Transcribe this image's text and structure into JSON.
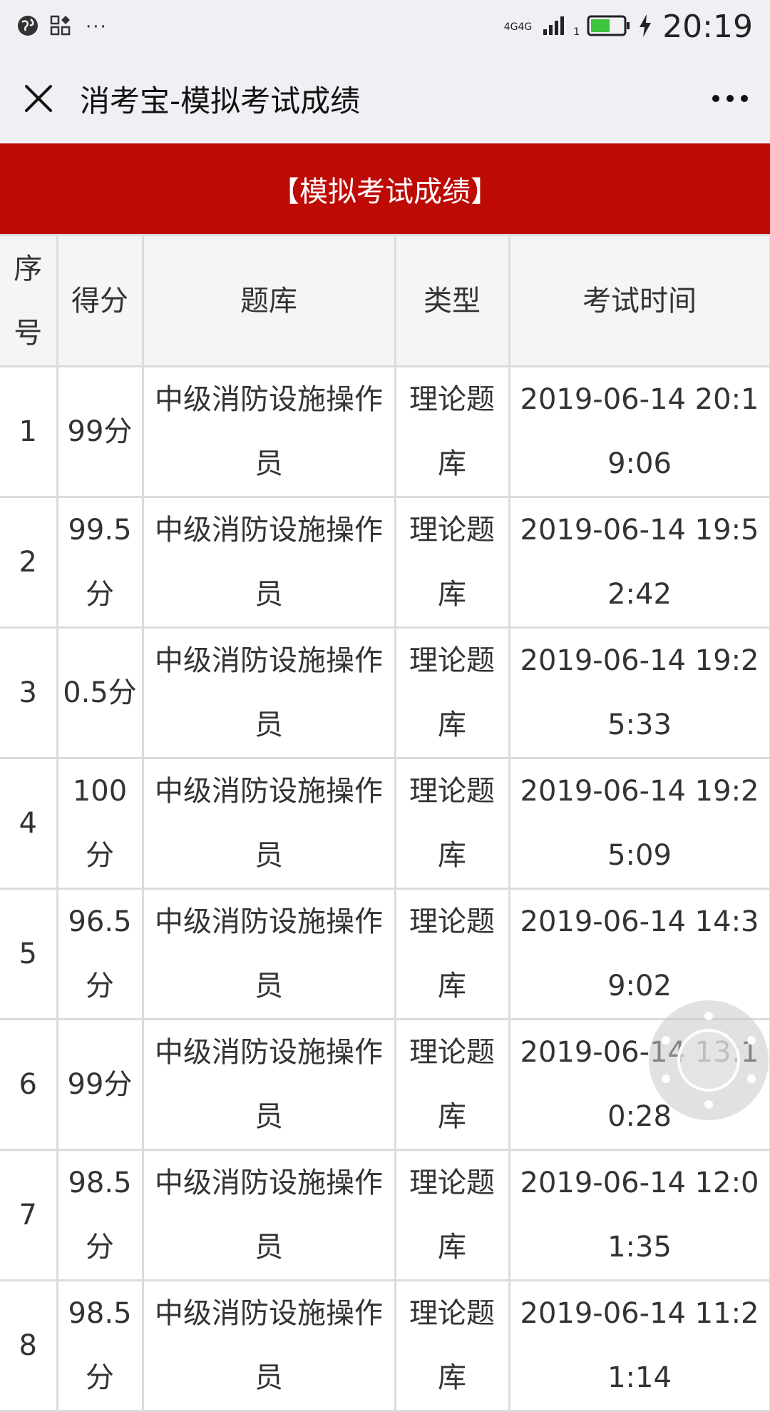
{
  "status_bar": {
    "network_1": "4G",
    "network_2": "4G",
    "sim": "1",
    "time": "20:19"
  },
  "nav": {
    "title": "消考宝-模拟考试成绩"
  },
  "banner": {
    "title": "【模拟考试成绩】"
  },
  "table": {
    "headers": [
      "序号",
      "得分",
      "题库",
      "类型",
      "考试时间"
    ],
    "rows": [
      {
        "no": "1",
        "score": "99分",
        "bank": "中级消防设施操作员",
        "type": "理论题库",
        "time": "2019-06-14 20:19:06"
      },
      {
        "no": "2",
        "score": "99.5分",
        "bank": "中级消防设施操作员",
        "type": "理论题库",
        "time": "2019-06-14 19:52:42"
      },
      {
        "no": "3",
        "score": "0.5分",
        "bank": "中级消防设施操作员",
        "type": "理论题库",
        "time": "2019-06-14 19:25:33"
      },
      {
        "no": "4",
        "score": "100分",
        "bank": "中级消防设施操作员",
        "type": "理论题库",
        "time": "2019-06-14 19:25:09"
      },
      {
        "no": "5",
        "score": "96.5分",
        "bank": "中级消防设施操作员",
        "type": "理论题库",
        "time": "2019-06-14 14:39:02"
      },
      {
        "no": "6",
        "score": "99分",
        "bank": "中级消防设施操作员",
        "type": "理论题库",
        "time": "2019-06-14 13:10:28"
      },
      {
        "no": "7",
        "score": "98.5分",
        "bank": "中级消防设施操作员",
        "type": "理论题库",
        "time": "2019-06-14 12:01:35"
      },
      {
        "no": "8",
        "score": "98.5分",
        "bank": "中级消防设施操作员",
        "type": "理论题库",
        "time": "2019-06-14 11:21:14"
      }
    ]
  },
  "colors": {
    "banner": "#be0a05",
    "nav_bg": "#efeff4",
    "grid": "#dcdcdc"
  },
  "icons": {
    "status_left": [
      "globe-icon",
      "app-grid-icon",
      "more-dots-icon"
    ],
    "status_right": [
      "signal-icon",
      "battery-icon",
      "charging-icon"
    ],
    "nav": [
      "close-icon",
      "more-icon"
    ]
  }
}
